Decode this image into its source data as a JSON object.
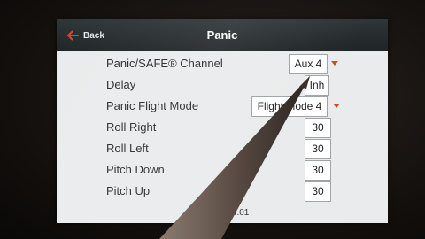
{
  "header": {
    "back_label": "Back",
    "title": "Panic"
  },
  "rows": [
    {
      "label": "Panic/SAFE® Channel",
      "value": "Aux 4"
    },
    {
      "label": "Delay",
      "value": "Inh"
    },
    {
      "label": "Panic Flight Mode",
      "value": "Flight Mode 4"
    },
    {
      "label": "Roll Right",
      "value": "30"
    },
    {
      "label": "Roll Left",
      "value": "30"
    },
    {
      "label": "Pitch Down",
      "value": "30"
    },
    {
      "label": "Pitch Up",
      "value": "30"
    }
  ],
  "footer": {
    "version_text": "2.34.01"
  },
  "colors": {
    "accent": "#d04a1f",
    "title_bar": "#262c2e",
    "screen_bg": "#e9ebec"
  },
  "icons": {
    "back": "back-arrow-icon",
    "dropdown": "dropdown-arrow-icon"
  }
}
